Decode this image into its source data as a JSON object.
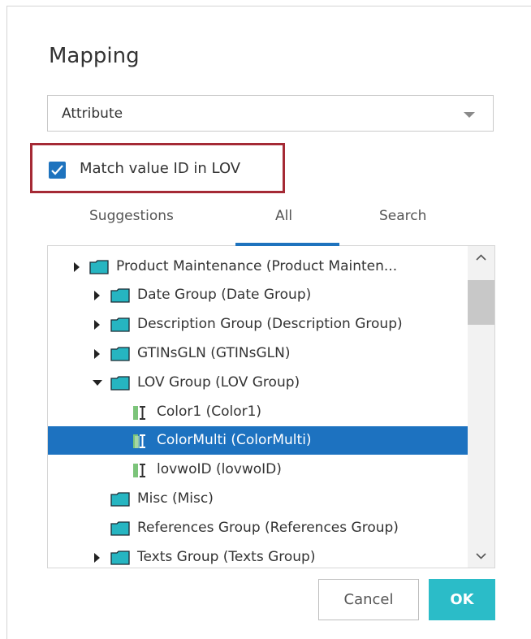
{
  "dialog": {
    "title": "Mapping",
    "select": {
      "value": "Attribute"
    },
    "checkbox": {
      "label": "Match value ID in LOV",
      "checked": true
    },
    "tabs": [
      {
        "label": "Suggestions",
        "active": false
      },
      {
        "label": "All",
        "active": true
      },
      {
        "label": "Search",
        "active": false
      }
    ],
    "tree": [
      {
        "label": "Product Maintenance (Product Mainten...",
        "type": "folder",
        "expander": "collapsed"
      },
      {
        "label": "Date Group (Date Group)",
        "type": "folder",
        "expander": "collapsed"
      },
      {
        "label": "Description Group (Description Group)",
        "type": "folder",
        "expander": "collapsed"
      },
      {
        "label": "GTINsGLN (GTINsGLN)",
        "type": "folder",
        "expander": "collapsed"
      },
      {
        "label": "LOV Group (LOV Group)",
        "type": "folder",
        "expander": "expanded"
      },
      {
        "label": "Color1 (Color1)",
        "type": "attribute",
        "expander": "none"
      },
      {
        "label": "ColorMulti (ColorMulti)",
        "type": "attribute",
        "expander": "none",
        "selected": true
      },
      {
        "label": "lovwoID (lovwoID)",
        "type": "attribute",
        "expander": "none"
      },
      {
        "label": "Misc (Misc)",
        "type": "folder",
        "expander": "none"
      },
      {
        "label": "References Group (References Group)",
        "type": "folder",
        "expander": "none"
      },
      {
        "label": "Texts Group (Texts Group)",
        "type": "folder",
        "expander": "collapsed"
      }
    ],
    "buttons": {
      "cancel": "Cancel",
      "ok": "OK"
    }
  },
  "colors": {
    "accent": "#1e73be",
    "selection": "#1d72c0",
    "highlight_border": "#a52a35",
    "ok_button": "#2bbcc8",
    "folder": "#26b5c1"
  },
  "icons": {
    "folder": "folder-icon",
    "attribute": "attribute-icon",
    "expand": "triangle-right-icon",
    "collapse": "triangle-down-icon"
  }
}
